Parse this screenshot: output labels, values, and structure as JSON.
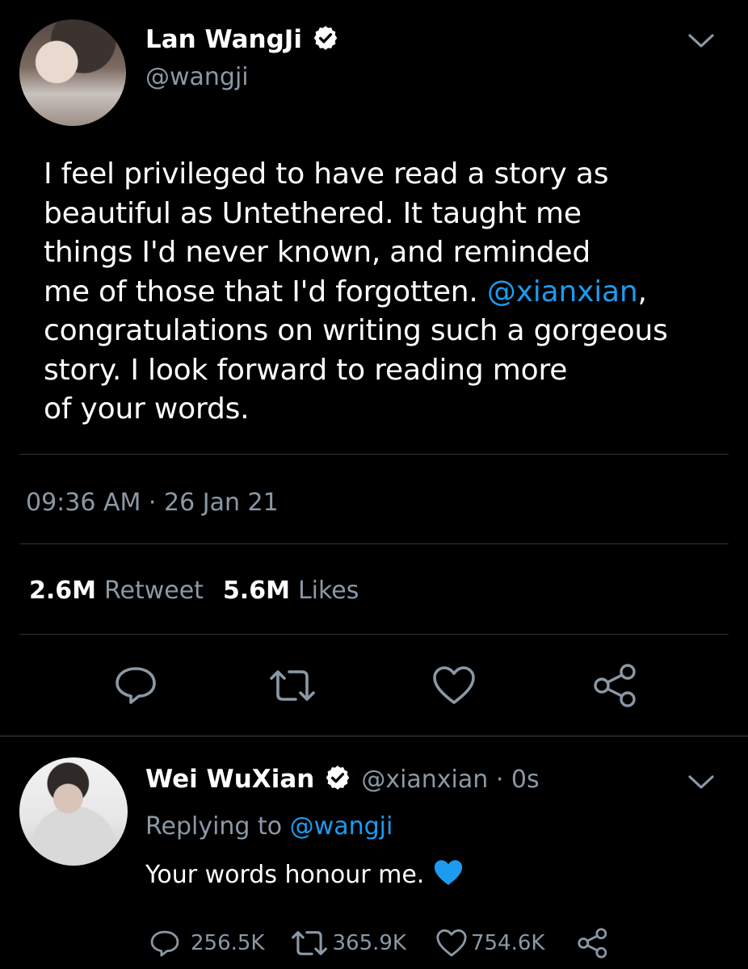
{
  "tweet": {
    "author_name": "Lan WangJi",
    "author_handle": "@wangji",
    "lines": [
      "I feel privileged to have read a story as",
      "beautiful as Untethered. It taught me",
      "things I'd never known, and reminded",
      "me of those that I'd forgotten. ",
      "congratulations on writing such a gorgeous",
      "story. I look forward to reading more",
      "of your words."
    ],
    "mention": "@xianxian",
    "mention_suffix": ",",
    "timestamp": "09:36 AM · 26 Jan 21",
    "retweets_count": "2.6M",
    "retweets_label": "Retweet",
    "likes_count": "5.6M",
    "likes_label": "Likes"
  },
  "reply": {
    "author_name": "Wei WuXian",
    "author_handle_time": "@xianxian · 0s",
    "replying_prefix": "Replying to ",
    "replying_handle": "@wangji",
    "text": "Your words honour me.",
    "reply_count": "256.5K",
    "retweet_count": "365.9K",
    "like_count": "754.6K"
  },
  "colors": {
    "background": "#000000",
    "text": "#ffffff",
    "muted": "#8b98a5",
    "link": "#1d9bf0",
    "divider": "#2f3336",
    "heart_emoji": "#1d9bf0"
  },
  "icons": {
    "verified": "verified-badge-icon",
    "chevron": "chevron-down-icon",
    "reply": "reply-icon",
    "retweet": "retweet-icon",
    "like": "heart-icon",
    "share": "share-icon",
    "emoji": "blue-heart-emoji-icon"
  }
}
